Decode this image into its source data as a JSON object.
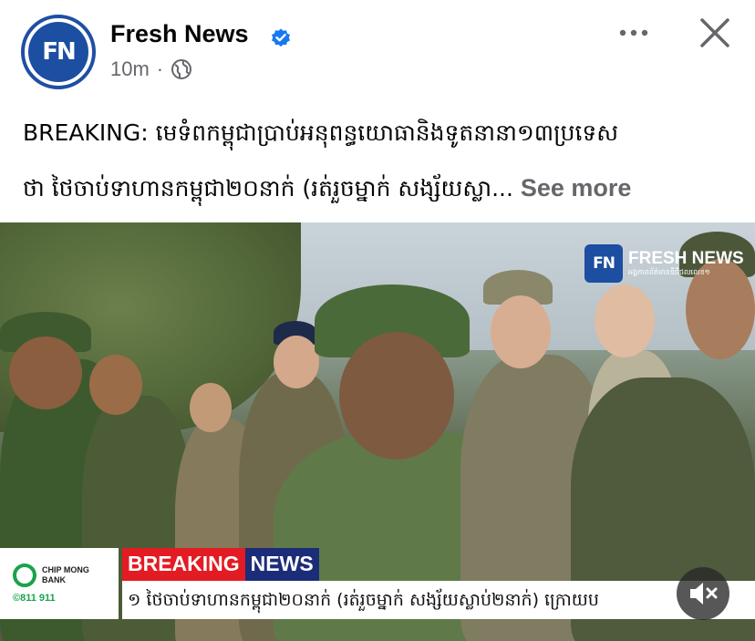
{
  "post": {
    "page_name": "Fresh News",
    "avatar_text": "FN",
    "time": "10m",
    "separator": "·",
    "caption_line1": "BREAKING: មេទំពកម្ពុជាប្រាប់អនុពន្ធយោធានិងទូតនានា១៣ប្រទេស",
    "caption_line2": "ថា ថៃចាប់ទាហានកម្ពុជា២០នាក់ (រត់រួចម្នាក់ សង្ស័យស្លា...",
    "see_more": "See more"
  },
  "video": {
    "watermark_logo": "FN",
    "watermark_title": "FRESH NEWS",
    "watermark_sub": "អង្គភាពព័ត៌មានឌីជីថលលេខ១",
    "sponsor_name": "CHIP MONG BANK",
    "sponsor_phone": "©811 911",
    "breaking_label": "BREAKING",
    "news_label": "NEWS",
    "ticker_text": "១ ថៃចាប់ទាហានកម្ពុជា២០នាក់ (រត់រួចម្នាក់ សង្ស័យស្លាប់២នាក់) ក្រោយប"
  },
  "icons": {
    "verified": "verified-badge-icon",
    "globe": "globe-icon",
    "more": "more-horizontal-icon",
    "close": "close-icon",
    "mute": "speaker-muted-icon"
  },
  "colors": {
    "brand_blue": "#1c4ea1",
    "verified_blue": "#1877f2",
    "breaking_red": "#e31b23",
    "news_navy": "#1b2c78",
    "muted_text": "#65676b"
  }
}
